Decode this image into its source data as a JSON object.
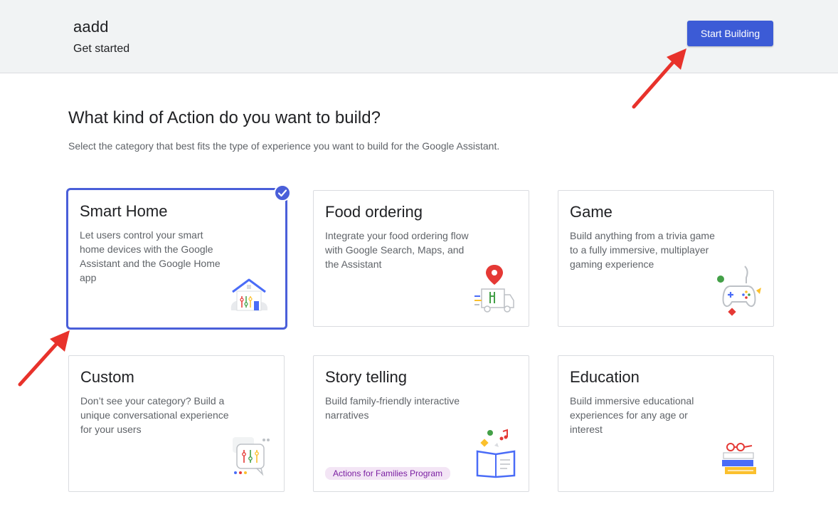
{
  "header": {
    "project_name": "aadd",
    "subtitle": "Get started",
    "start_button": "Start Building"
  },
  "main": {
    "headline": "What kind of Action do you want to build?",
    "lead": "Select the category that best fits the type of experience you want to build for the Google Assistant."
  },
  "cards": [
    {
      "title": "Smart Home",
      "description": "Let users control your smart home devices with the Google Assistant and the Google Home app",
      "selected": true,
      "icon": "smart-home-icon"
    },
    {
      "title": "Food ordering",
      "description": "Integrate your food ordering flow with Google Search, Maps, and the Assistant",
      "selected": false,
      "icon": "food-ordering-icon"
    },
    {
      "title": "Game",
      "description": "Build anything from a trivia game to a fully immersive, multiplayer gaming experience",
      "selected": false,
      "icon": "game-controller-icon"
    },
    {
      "title": "Custom",
      "description": "Don’t see your category? Build a unique conversational experience for your users",
      "selected": false,
      "icon": "custom-chat-icon"
    },
    {
      "title": "Story telling",
      "description": "Build family-friendly interactive narratives",
      "selected": false,
      "icon": "open-book-icon",
      "tag": "Actions for Families Program"
    },
    {
      "title": "Education",
      "description": "Build immersive educational experiences for any age or interest",
      "selected": false,
      "icon": "books-glasses-icon"
    }
  ],
  "colors": {
    "accent": "#4a5fd9",
    "button": "#3c5bd6",
    "header_bg": "#f1f3f4",
    "annotation_arrow": "#e8322b",
    "tag_bg": "#f3e5f5",
    "tag_text": "#7b1fa2"
  }
}
